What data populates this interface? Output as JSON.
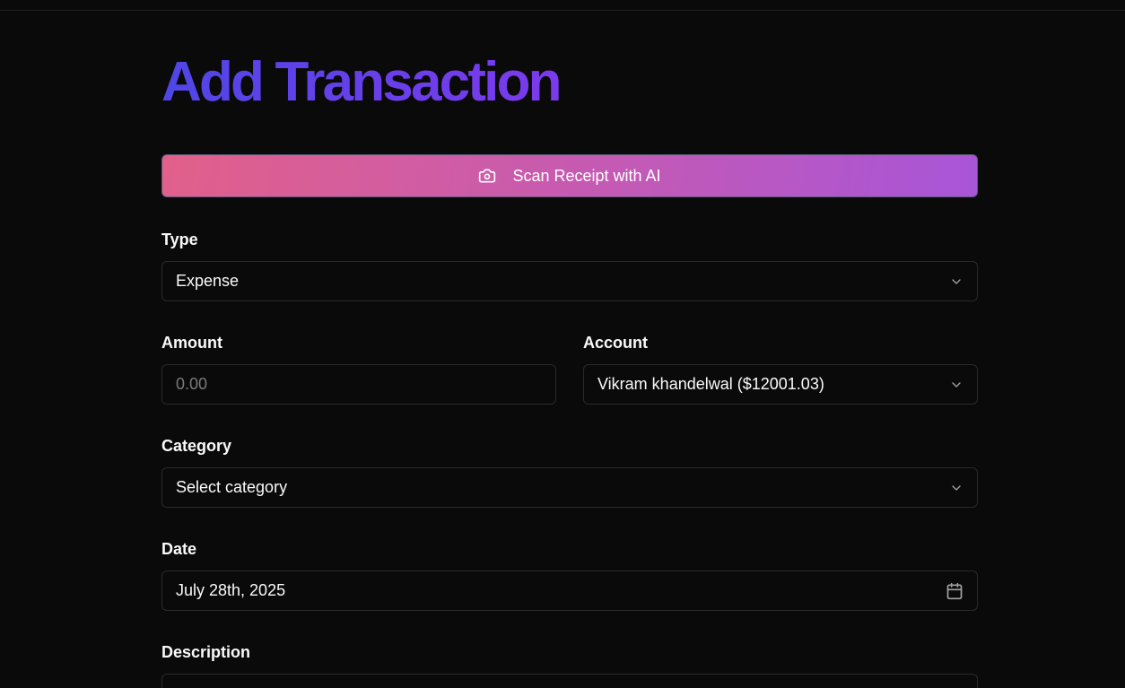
{
  "page": {
    "title": "Add Transaction"
  },
  "scan_button": {
    "label": "Scan Receipt with AI",
    "icon": "camera-icon"
  },
  "form": {
    "type": {
      "label": "Type",
      "value": "Expense"
    },
    "amount": {
      "label": "Amount",
      "value": "",
      "placeholder": "0.00"
    },
    "account": {
      "label": "Account",
      "value": "Vikram khandelwal ($12001.03)"
    },
    "category": {
      "label": "Category",
      "value": "Select category"
    },
    "date": {
      "label": "Date",
      "value": "July 28th, 2025",
      "icon": "calendar-icon"
    },
    "description": {
      "label": "Description"
    }
  },
  "colors": {
    "background": "#0a0a0a",
    "title_gradient_start": "#4f46e5",
    "title_gradient_end": "#7c3aed",
    "scan_gradient_start": "#e2608a",
    "scan_gradient_end": "#a855d8",
    "border": "#2a2a2a"
  }
}
